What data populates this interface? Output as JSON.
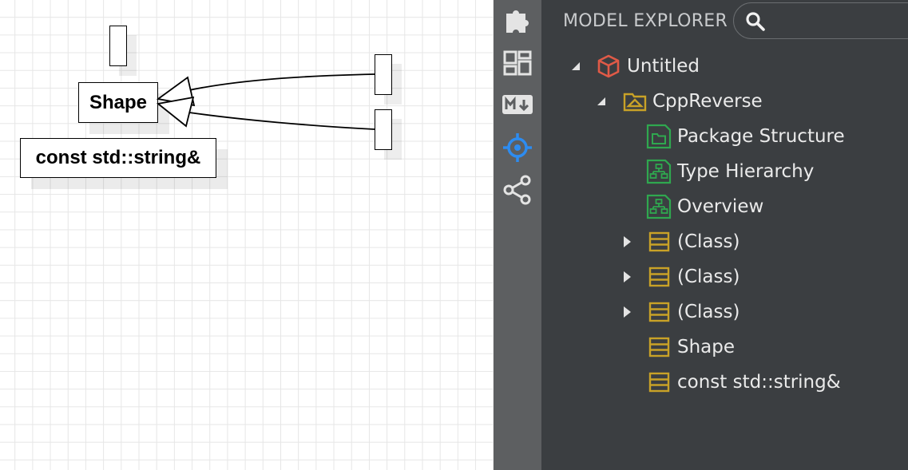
{
  "diagram": {
    "nodes": {
      "shape": "Shape",
      "const_string": "const std::string&"
    }
  },
  "activity_bar": {
    "icons": [
      "puzzle-icon",
      "layout-icon",
      "markdown-icon",
      "crosshair-icon",
      "share-icon"
    ],
    "active_color": "#2d8cf0"
  },
  "explorer": {
    "title": "MODEL EXPLORER",
    "search": {
      "value": "",
      "placeholder": ""
    },
    "tree": [
      {
        "label": "Untitled",
        "icon": "model-icon",
        "expanded": true
      },
      {
        "label": "CppReverse",
        "icon": "package-icon",
        "expanded": true
      },
      {
        "label": "Package Structure",
        "icon": "package-diagram-icon"
      },
      {
        "label": "Type Hierarchy",
        "icon": "class-diagram-icon"
      },
      {
        "label": "Overview",
        "icon": "class-diagram-icon"
      },
      {
        "label": "(Class)",
        "icon": "class-icon",
        "expanded": false
      },
      {
        "label": "(Class)",
        "icon": "class-icon",
        "expanded": false
      },
      {
        "label": "(Class)",
        "icon": "class-icon",
        "expanded": false
      },
      {
        "label": "Shape",
        "icon": "class-icon"
      },
      {
        "label": "const std::string&",
        "icon": "class-icon"
      }
    ]
  },
  "colors": {
    "model": "#e05a47",
    "package": "#c9a227",
    "diagram": "#2fa84f",
    "class": "#c9a227"
  }
}
